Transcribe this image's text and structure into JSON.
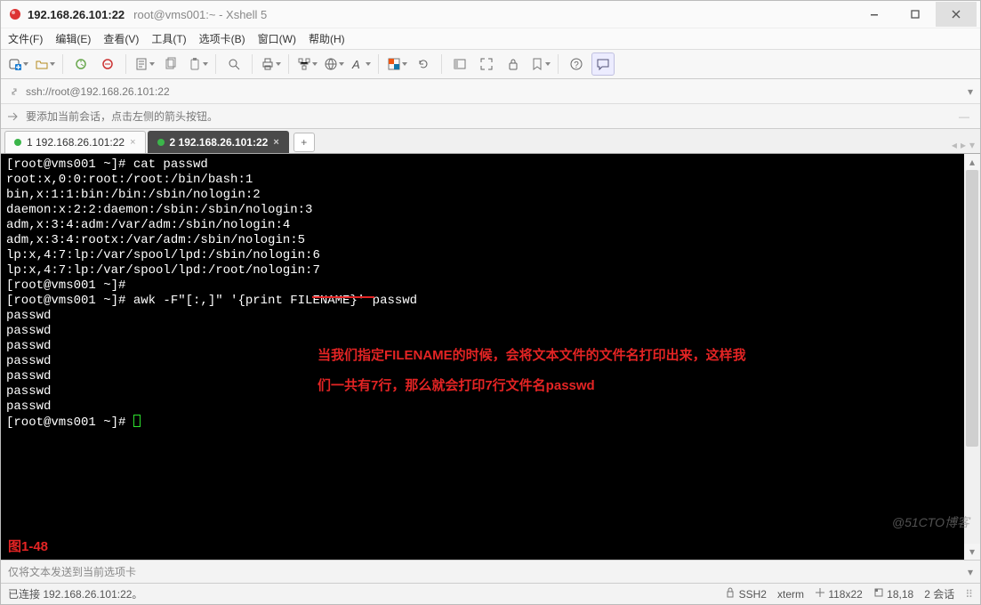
{
  "window": {
    "title_main": "192.168.26.101:22",
    "title_sub": "root@vms001:~ - Xshell 5"
  },
  "menu": {
    "items": [
      "文件(F)",
      "编辑(E)",
      "查看(V)",
      "工具(T)",
      "选项卡(B)",
      "窗口(W)",
      "帮助(H)"
    ]
  },
  "address": {
    "value": "ssh://root@192.168.26.101:22"
  },
  "infobar": {
    "text": "要添加当前会话，点击左侧的箭头按钮。"
  },
  "tabs": [
    {
      "label": "1 192.168.26.101:22",
      "active": false
    },
    {
      "label": "2 192.168.26.101:22",
      "active": true
    }
  ],
  "terminal": {
    "lines": [
      "[root@vms001 ~]# cat passwd",
      "root:x,0:0:root:/root:/bin/bash:1",
      "bin,x:1:1:bin:/bin:/sbin/nologin:2",
      "daemon:x:2:2:daemon:/sbin:/sbin/nologin:3",
      "adm,x:3:4:adm:/var/adm:/sbin/nologin:4",
      "adm,x:3:4:rootx:/var/adm:/sbin/nologin:5",
      "lp:x,4:7:lp:/var/spool/lpd:/sbin/nologin:6",
      "lp:x,4:7:lp:/var/spool/lpd:/root/nologin:7",
      "[root@vms001 ~]#",
      "[root@vms001 ~]# awk -F\"[:,]\" '{print FILENAME}' passwd",
      "passwd",
      "passwd",
      "passwd",
      "passwd",
      "passwd",
      "passwd",
      "passwd",
      "[root@vms001 ~]# "
    ],
    "annotation_line1": "当我们指定FILENAME的时候，会将文本文件的文件名打印出来，这样我",
    "annotation_line2": "们一共有7行，那么就会打印7行文件名passwd",
    "figure_label": "图1-48"
  },
  "sendbar": {
    "placeholder": "仅将文本发送到当前选项卡"
  },
  "statusbar": {
    "left": "已连接 192.168.26.101:22。",
    "ssh": "SSH2",
    "term": "xterm",
    "size": "118x22",
    "pos": "18,18",
    "sess": "2 会话"
  },
  "watermark": "@51CTO博客"
}
